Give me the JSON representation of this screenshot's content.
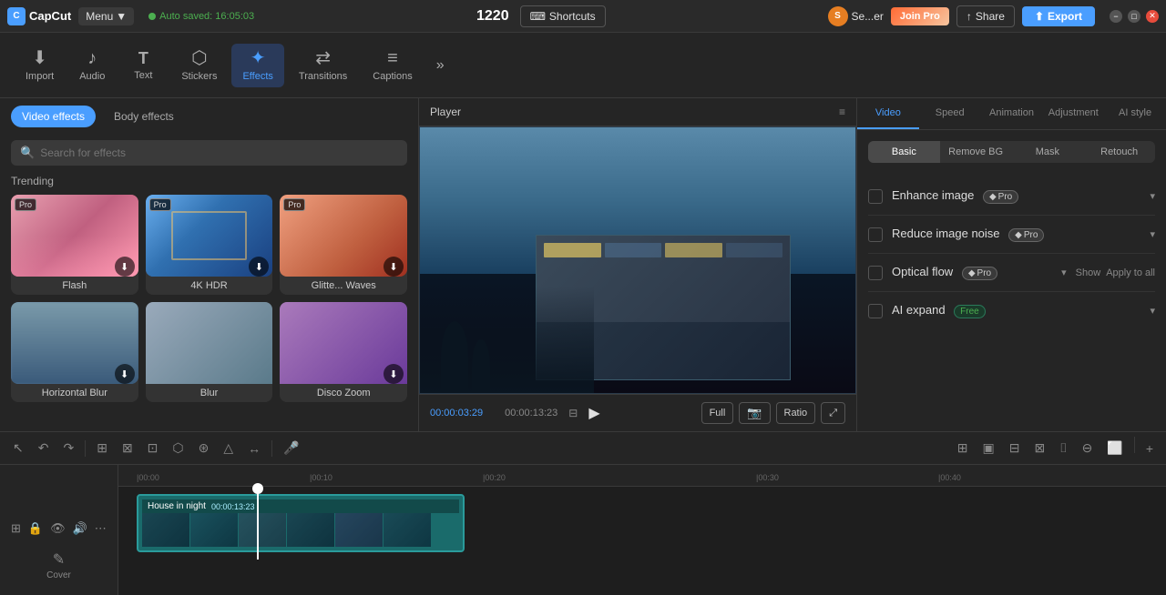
{
  "app": {
    "name": "CapCut",
    "logo_letter": "C"
  },
  "top_bar": {
    "menu_label": "Menu",
    "menu_arrow": "▼",
    "autosave_text": "Auto saved: 16:05:03",
    "counter": "1220",
    "shortcuts_label": "Shortcuts",
    "user_initial": "S",
    "user_name": "Se...er",
    "join_pro_label": "Join Pro",
    "share_label": "Share",
    "export_label": "Export",
    "win_minimize": "−",
    "win_restore": "□",
    "win_close": "✕"
  },
  "toolbar": {
    "items": [
      {
        "id": "import",
        "icon": "⬇",
        "label": "Import"
      },
      {
        "id": "audio",
        "icon": "♪",
        "label": "Audio"
      },
      {
        "id": "text",
        "icon": "T",
        "label": "Text"
      },
      {
        "id": "stickers",
        "icon": "◉",
        "label": "Stickers"
      },
      {
        "id": "effects",
        "icon": "✦",
        "label": "Effects"
      },
      {
        "id": "transitions",
        "icon": "⇄",
        "label": "Transitions"
      },
      {
        "id": "captions",
        "icon": "≡",
        "label": "Captions"
      }
    ],
    "more_icon": "»"
  },
  "effects_panel": {
    "video_effects_tab": "Video effects",
    "body_effects_tab": "Body effects",
    "search_placeholder": "Search for effects",
    "section_trending": "Trending",
    "cards": [
      {
        "id": "flash",
        "label": "Flash",
        "is_pro": true,
        "color1": "#ff6b9d",
        "color2": "#c44569",
        "has_download": true
      },
      {
        "id": "4khdr",
        "label": "4K HDR",
        "is_pro": true,
        "color1": "#4a9eff",
        "color2": "#1a4080",
        "has_download": true
      },
      {
        "id": "glitter_waves",
        "label": "Glitte... Waves",
        "is_pro": true,
        "color1": "#ff9a7b",
        "color2": "#c04a2a",
        "has_download": true
      },
      {
        "id": "horizontal_blur",
        "label": "Horizontal Blur",
        "is_pro": false,
        "color1": "#6a8aaa",
        "color2": "#3a5a7a",
        "has_download": true
      },
      {
        "id": "blur2",
        "label": "Blur",
        "is_pro": false,
        "color1": "#8a9aaa",
        "color2": "#5a6a7a",
        "has_download": false
      },
      {
        "id": "disco_zoom",
        "label": "Disco Zoom",
        "is_pro": false,
        "color1": "#9a6aaa",
        "color2": "#6a3a8a",
        "has_download": true
      }
    ]
  },
  "player": {
    "title": "Player",
    "menu_icon": "≡",
    "time_current": "00:00:03:29",
    "time_total": "00:00:13:23",
    "play_icon": "▶",
    "btn_full": "Full",
    "btn_ratio": "Ratio",
    "btn_expand": "⤢"
  },
  "right_panel": {
    "tabs": [
      "Video",
      "Speed",
      "Animation",
      "Adjustment",
      "AI style"
    ],
    "active_tab": "Video",
    "sub_tabs": [
      "Basic",
      "Remove BG",
      "Mask",
      "Retouch"
    ],
    "active_sub_tab": "Basic",
    "ai_options": [
      {
        "id": "enhance_image",
        "label": "Enhance image",
        "tag_type": "pro",
        "tag_label": "Pro",
        "has_show": false,
        "has_apply_all": false
      },
      {
        "id": "reduce_noise",
        "label": "Reduce image noise",
        "tag_type": "pro",
        "tag_label": "Pro",
        "has_show": false,
        "has_apply_all": false
      },
      {
        "id": "optical_flow",
        "label": "Optical flow",
        "tag_type": "pro",
        "tag_label": "Pro",
        "show_label": "Show",
        "apply_all_label": "Apply to all",
        "has_show": true,
        "has_apply_all": true
      },
      {
        "id": "ai_expand",
        "label": "AI expand",
        "tag_type": "free",
        "tag_label": "Free",
        "has_show": false,
        "has_apply_all": false
      }
    ]
  },
  "timeline": {
    "tools": [
      "↶",
      "↷",
      "↕",
      "⊞",
      "⬡",
      "⊠",
      "△",
      "⊛",
      "↔"
    ],
    "right_tools": [
      "⊞",
      "▣",
      "⊟",
      "⊠",
      "⌷",
      "⊖",
      "⬜"
    ],
    "ruler_marks": [
      "00:00",
      "|00:10",
      "|00:20",
      "|00:30",
      "|00:40"
    ],
    "clip": {
      "label": "House in night",
      "duration": "00:00:13:23",
      "color": "#1a6b6b",
      "border_color": "#2a9b9b"
    },
    "cover_label": "Cover",
    "cover_icon": "✎",
    "track_icons": [
      "⊞",
      "🔒",
      "👁",
      "🔊",
      "⋯"
    ]
  },
  "colors": {
    "accent": "#4a9eff",
    "pro_bg": "#3a3a3a",
    "free_bg": "#1a3a2a",
    "timeline_clip": "#1a6b6b",
    "timeline_border": "#2a9b9b",
    "active_tab_line": "#4a9eff"
  }
}
